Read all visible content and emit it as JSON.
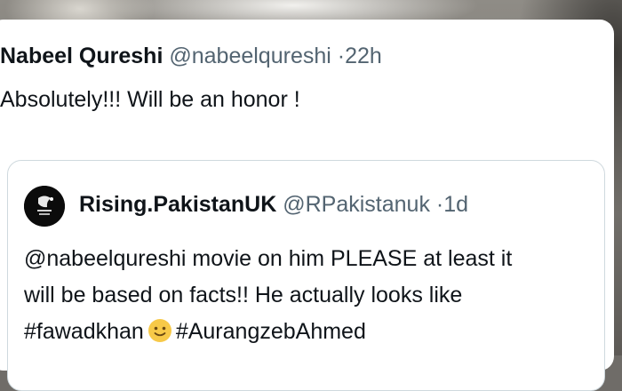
{
  "tweet": {
    "author_name": "Nabeel Qureshi",
    "author_handle": "@nabeelqureshi",
    "separator": "·",
    "time": "22h",
    "text": "Absolutely!!! Will be an honor !"
  },
  "quoted_tweet": {
    "avatar_icon": "rising-pakistan-logo-icon",
    "author_name": "Rising.PakistanUK",
    "author_handle": "@RPakistanuk",
    "separator": "·",
    "time": "1d",
    "line1": "@nabeelqureshi movie on him PLEASE at least it",
    "line2": "will be based on facts!! He actually looks like",
    "line3_hashtag1": "#fawadkhan",
    "line3_emoji": "slightly-smiling-face-icon",
    "line3_hashtag2": "#AurangzebAhmed"
  },
  "colors": {
    "text_primary": "#0f1419",
    "text_secondary": "#536471",
    "border": "#cfd9de",
    "card_bg": "#ffffff",
    "emoji_yellow": "#f7c948"
  }
}
